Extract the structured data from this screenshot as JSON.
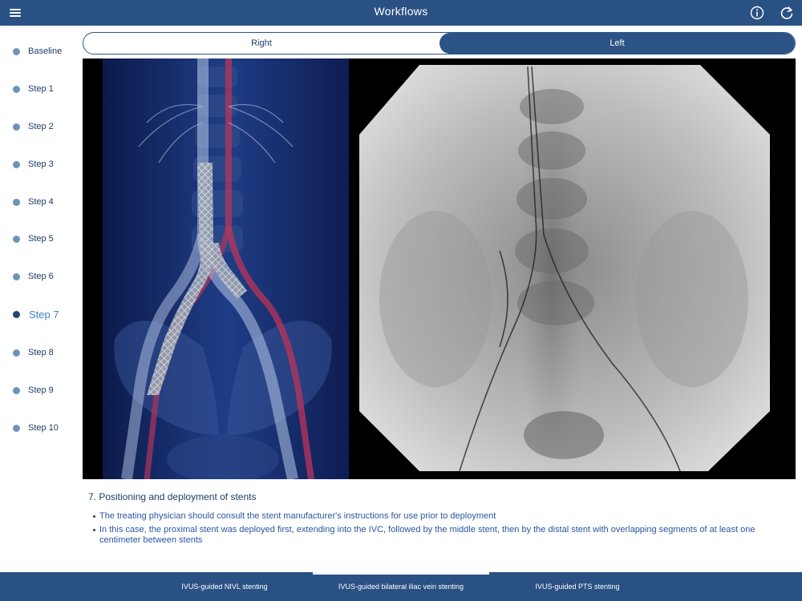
{
  "header": {
    "title": "Workflows",
    "menu_icon": "hamburger-menu-icon",
    "info_icon": "info-icon",
    "refresh_icon": "refresh-icon"
  },
  "sidebar": {
    "items": [
      {
        "label": "Baseline",
        "active": false
      },
      {
        "label": "Step 1",
        "active": false
      },
      {
        "label": "Step 2",
        "active": false
      },
      {
        "label": "Step 3",
        "active": false
      },
      {
        "label": "Step 4",
        "active": false
      },
      {
        "label": "Step 5",
        "active": false
      },
      {
        "label": "Step 6",
        "active": false
      },
      {
        "label": "Step 7",
        "active": true
      },
      {
        "label": "Step 8",
        "active": false
      },
      {
        "label": "Step 9",
        "active": false
      },
      {
        "label": "Step 10",
        "active": false
      }
    ]
  },
  "segment": {
    "right_label": "Right",
    "left_label": "Left",
    "selected": "Left"
  },
  "content": {
    "title": "7. Positioning and deployment of stents",
    "bullets": [
      "The treating physician should consult the stent manufacturer's instructions for use prior to deployment",
      "In this case, the proximal stent was deployed first, extending into the IVC, followed by the middle stent, then by the distal stent with overlapping segments of at least one centimeter between stents"
    ]
  },
  "bottom_tabs": [
    {
      "label": "IVUS-guided NIVL stenting",
      "active": false
    },
    {
      "label": "IVUS-guided bilateral iliac vein stenting",
      "active": true
    },
    {
      "label": "IVUS-guided PTS stenting",
      "active": false
    }
  ],
  "colors": {
    "brand": "#2a5183",
    "accent": "#3e83c9",
    "sidebar_dot": "#6f93b8"
  }
}
